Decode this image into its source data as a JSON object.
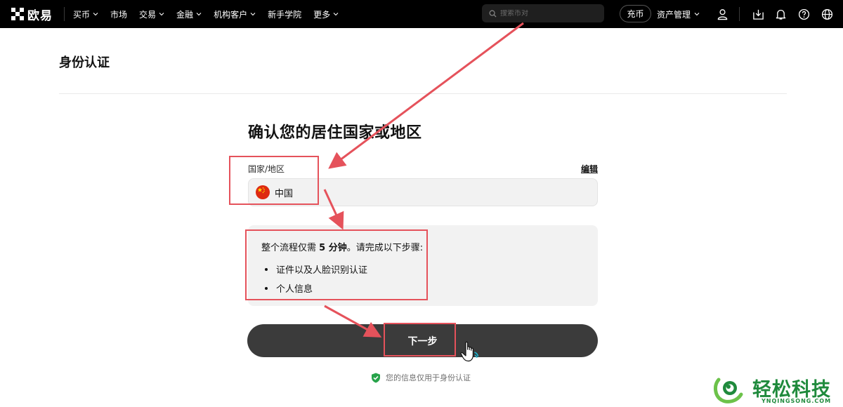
{
  "nav": {
    "logo_text": "欧易",
    "items": [
      {
        "label": "买币",
        "has_dropdown": true
      },
      {
        "label": "市场",
        "has_dropdown": false
      },
      {
        "label": "交易",
        "has_dropdown": true
      },
      {
        "label": "金融",
        "has_dropdown": true
      },
      {
        "label": "机构客户",
        "has_dropdown": true
      },
      {
        "label": "新手学院",
        "has_dropdown": false
      },
      {
        "label": "更多",
        "has_dropdown": true
      }
    ],
    "search_placeholder": "搜索币对",
    "deposit_label": "充币",
    "asset_label": "资产管理",
    "icons": [
      "user-icon",
      "download-icon",
      "bell-icon",
      "help-icon",
      "globe-icon"
    ]
  },
  "page": {
    "title": "身份认证"
  },
  "form": {
    "heading": "确认您的居住国家或地区",
    "field_label": "国家/地区",
    "edit_label": "编辑",
    "country_value": "中国",
    "country_flag": "china-flag-icon",
    "info": {
      "intro_prefix": "整个流程仅需 ",
      "intro_bold": "5 分钟",
      "intro_suffix": "。请完成以下步骤:",
      "steps": [
        "证件以及人脸识别认证",
        "个人信息"
      ]
    },
    "next_label": "下一步",
    "privacy_note": "您的信息仅用于身份认证"
  },
  "colors": {
    "annotation": "#e5525b",
    "nav_bg": "#000000",
    "button_bg": "#3b3b3b",
    "watermark": "#1f8a3c",
    "shield": "#27a34a"
  },
  "watermark": {
    "text": "轻松科技",
    "subtext": "YNQINGSONG.COM"
  }
}
